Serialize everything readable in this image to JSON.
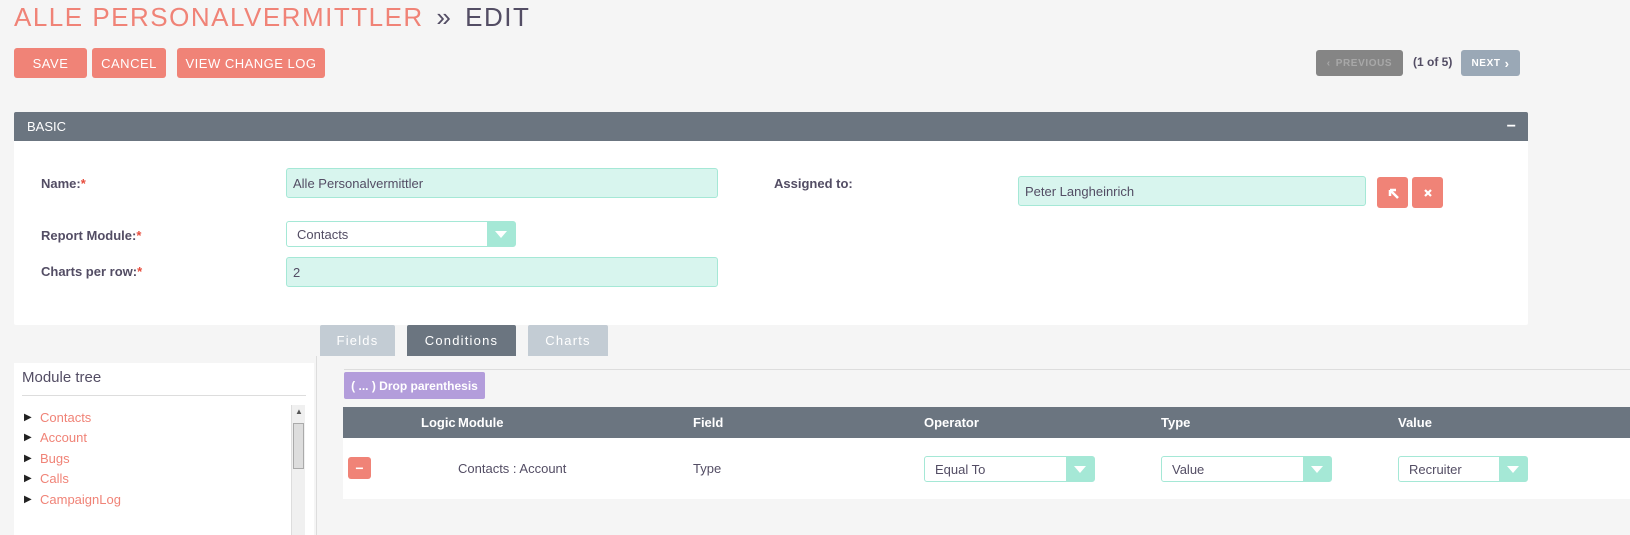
{
  "title": {
    "module": "ALLE PERSONALVERMITTLER",
    "separator": "»",
    "action": "EDIT"
  },
  "actions": {
    "save": "SAVE",
    "cancel": "CANCEL",
    "view_change_log": "VIEW CHANGE LOG"
  },
  "pager": {
    "previous": "PREVIOUS",
    "count": "(1 of 5)",
    "next": "NEXT"
  },
  "panel": {
    "title": "BASIC",
    "collapse": "−"
  },
  "form": {
    "name_label": "Name:",
    "name_value": "Alle Personalvermittler",
    "assigned_label": "Assigned to:",
    "assigned_value": "Peter Langheinrich",
    "module_label": "Report Module:",
    "module_value": "Contacts",
    "charts_label": "Charts per row:",
    "charts_value": "2",
    "required_marker": "*"
  },
  "tabs": [
    {
      "label": "Fields",
      "active": false
    },
    {
      "label": "Conditions",
      "active": true
    },
    {
      "label": "Charts",
      "active": false
    }
  ],
  "module_tree": {
    "title": "Module tree",
    "items": [
      "Contacts",
      "Account",
      "Bugs",
      "Calls",
      "CampaignLog"
    ]
  },
  "conditions": {
    "drop_label": "( ... ) Drop parenthesis",
    "headers": {
      "logic": "Logic",
      "module": "Module",
      "field": "Field",
      "operator": "Operator",
      "type": "Type",
      "value": "Value"
    },
    "rows": [
      {
        "delete": "−",
        "module": "Contacts : Account",
        "field": "Type",
        "operator": "Equal To",
        "type": "Value",
        "value": "Recruiter"
      }
    ]
  },
  "colors": {
    "accent": "#f08377",
    "header": "#6b7580",
    "field_bg": "#d8f5ee",
    "field_border": "#a5e8d6",
    "purple": "#b39ddb"
  }
}
